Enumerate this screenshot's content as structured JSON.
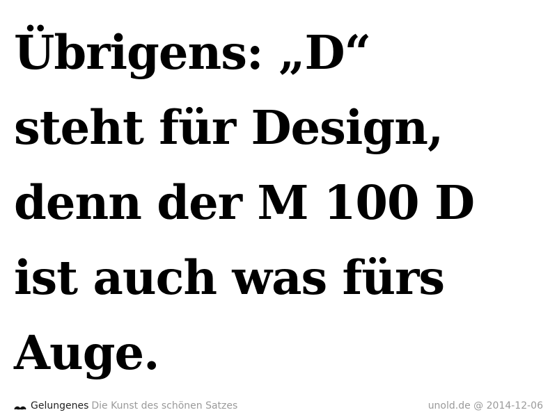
{
  "headline": {
    "lines": [
      "Übrigens: „D“",
      "steht für Design,",
      "denn der M 100 D",
      "ist auch was fürs",
      "Auge."
    ]
  },
  "footer": {
    "logo_icon": "mustache-icon",
    "brand": "Gelungenes",
    "tagline": "Die Kunst des schönen Satzes",
    "credit": "unold.de @ 2014-12-06"
  },
  "colors": {
    "text": "#000000",
    "brand": "#222222",
    "muted": "#9a9a9a",
    "background": "#ffffff"
  }
}
